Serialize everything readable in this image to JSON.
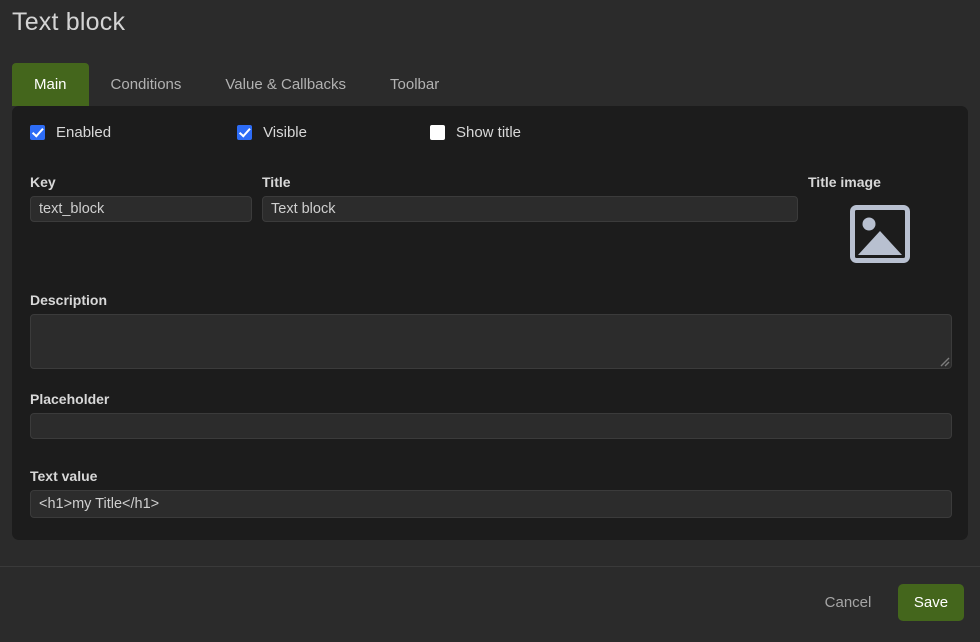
{
  "header": {
    "title": "Text block"
  },
  "tabs": [
    {
      "label": "Main",
      "active": true
    },
    {
      "label": "Conditions",
      "active": false
    },
    {
      "label": "Value & Callbacks",
      "active": false
    },
    {
      "label": "Toolbar",
      "active": false
    }
  ],
  "checkboxes": [
    {
      "label": "Enabled",
      "checked": true
    },
    {
      "label": "Visible",
      "checked": true
    },
    {
      "label": "Show title",
      "checked": false
    }
  ],
  "fields": {
    "key": {
      "label": "Key",
      "value": "text_block",
      "placeholder": ""
    },
    "title": {
      "label": "Title",
      "value": "Text block",
      "placeholder": ""
    },
    "title_image": {
      "label": "Title image",
      "icon": "image-placeholder-icon"
    },
    "description": {
      "label": "Description",
      "value": "",
      "placeholder": ""
    },
    "placeholder": {
      "label": "Placeholder",
      "value": "",
      "placeholder": ""
    },
    "text_value": {
      "label": "Text value",
      "value": "<h1>my Title</h1>",
      "placeholder": ""
    }
  },
  "footer": {
    "cancel_label": "Cancel",
    "save_label": "Save"
  },
  "colors": {
    "accent_green": "#44661c",
    "checkbox_blue": "#2d6cf6",
    "page_bg": "#2b2b2b",
    "panel_bg": "#1c1c1c",
    "input_bg": "#2c2c2c",
    "icon_gray": "#b8c0d0"
  }
}
